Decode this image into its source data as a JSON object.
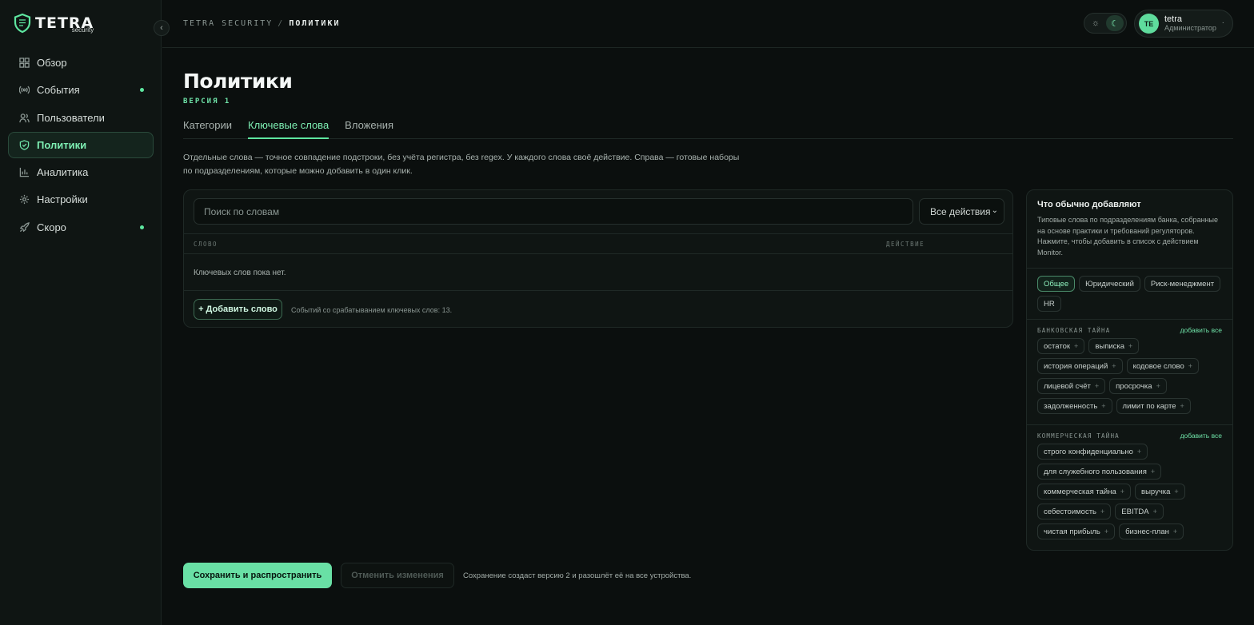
{
  "brand": {
    "name": "TETRA",
    "sub": "security"
  },
  "sidebar": {
    "items": [
      {
        "label": "Обзор",
        "icon": "grid-icon",
        "dot": false,
        "active": false
      },
      {
        "label": "События",
        "icon": "broadcast-icon",
        "dot": true,
        "active": false
      },
      {
        "label": "Пользователи",
        "icon": "users-icon",
        "dot": false,
        "active": false
      },
      {
        "label": "Политики",
        "icon": "shield-check-icon",
        "dot": false,
        "active": true
      },
      {
        "label": "Аналитика",
        "icon": "bar-chart-icon",
        "dot": false,
        "active": false
      },
      {
        "label": "Настройки",
        "icon": "gear-icon",
        "dot": false,
        "active": false
      },
      {
        "label": "Скоро",
        "icon": "rocket-icon",
        "dot": true,
        "active": false
      }
    ]
  },
  "header": {
    "breadcrumb_root": "TETRA SECURITY",
    "breadcrumb_sep": "/",
    "breadcrumb_current": "ПОЛИТИКИ",
    "user_initials": "TE",
    "user_name": "tetra",
    "user_role": "Администратор"
  },
  "page": {
    "title": "Политики",
    "version": "ВЕРСИЯ 1",
    "tabs": [
      "Категории",
      "Ключевые слова",
      "Вложения"
    ],
    "active_tab": 1,
    "description": "Отдельные слова — точное совпадение подстроки, без учёта регистра, без regex. У каждого слова своё действие. Справа — готовые наборы по подразделениям, которые можно добавить в один клик."
  },
  "keywords": {
    "search_placeholder": "Поиск по словам",
    "filter_value": "Все действия",
    "col_word": "СЛОВО",
    "col_action": "ДЕЙСТВИЕ",
    "empty_text": "Ключевых слов пока нет.",
    "add_label": "+ Добавить слово",
    "hits_text": "Событий со срабатыванием ключевых слов: 13."
  },
  "panel": {
    "title": "Что обычно добавляют",
    "description": "Типовые слова по подразделениям банка, собранные на основе практики и требований регуляторов. Нажмите, чтобы добавить в список с действием Monitor.",
    "departments": [
      "Общее",
      "Юридический",
      "Риск-менеджмент",
      "HR"
    ],
    "active_department": 0,
    "add_all_label": "добавить все",
    "sections": [
      {
        "title": "БАНКОВСКАЯ ТАЙНА",
        "words": [
          "остаток",
          "выписка",
          "история операций",
          "кодовое слово",
          "лицевой счёт",
          "просрочка",
          "задолженность",
          "лимит по карте"
        ]
      },
      {
        "title": "КОММЕРЧЕСКАЯ ТАЙНА",
        "words": [
          "строго конфиденциально",
          "для служебного пользования",
          "коммерческая тайна",
          "выручка",
          "себестоимость",
          "EBITDA",
          "чистая прибыль",
          "бизнес-план"
        ]
      }
    ]
  },
  "footer": {
    "save_label": "Сохранить и распространить",
    "cancel_label": "Отменить изменения",
    "note": "Сохранение создаст версию 2 и разошлёт её на все устройства."
  },
  "colors": {
    "accent": "#5ee6a0",
    "background": "#0b0f0e"
  }
}
